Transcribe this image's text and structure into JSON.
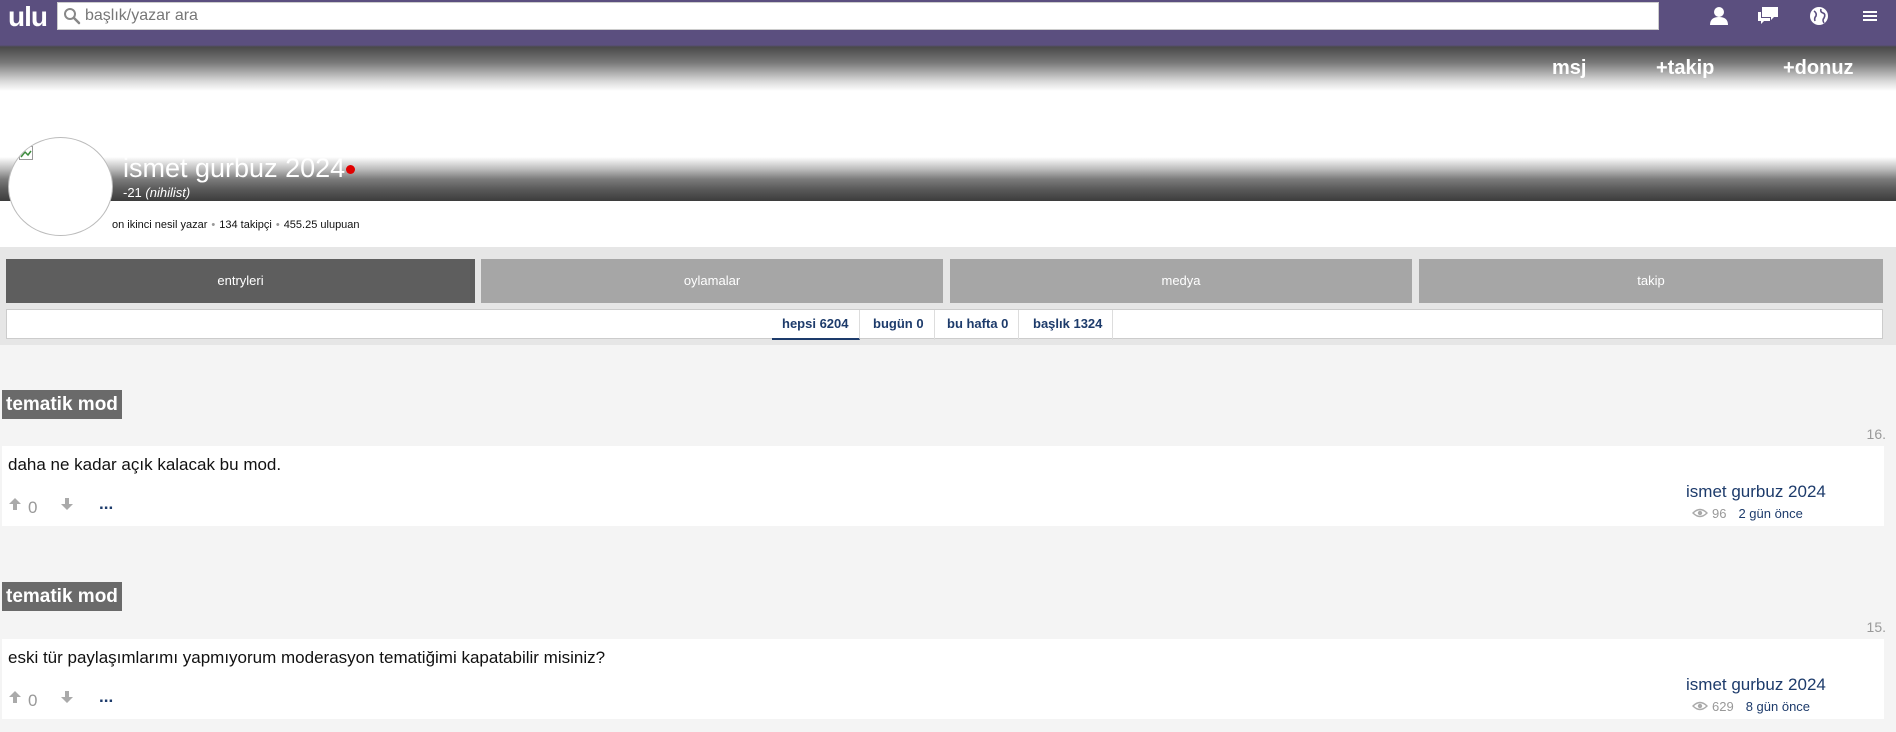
{
  "header": {
    "logo": "ulu",
    "search_placeholder": "başlık/yazar ara",
    "icons": [
      "user-icon",
      "messages-icon",
      "globe-icon",
      "menu-icon"
    ]
  },
  "cover": {
    "buttons": [
      "msj",
      "+takip",
      "+donuz"
    ]
  },
  "profile": {
    "name": "ismet gurbuz 2024",
    "score": "-21",
    "type": "(nihilist)",
    "stats": [
      "on ikinci nesil yazar",
      "134 takipçi",
      "455.25 ulupuan"
    ],
    "online_color": "#e00000"
  },
  "tabs": [
    {
      "label": "entryleri",
      "active": true
    },
    {
      "label": "oylamalar",
      "active": false
    },
    {
      "label": "medya",
      "active": false
    },
    {
      "label": "takip",
      "active": false
    }
  ],
  "subtabs": [
    {
      "label": "hepsi 6204",
      "active": true
    },
    {
      "label": "bugün 0",
      "active": false
    },
    {
      "label": "bu hafta 0",
      "active": false
    },
    {
      "label": "başlık 1324",
      "active": false
    }
  ],
  "entries": [
    {
      "topic": "tematik mod",
      "number": "16.",
      "text": "daha ne kadar açık kalacak bu mod.",
      "votes": "0",
      "more": "...",
      "author": "ismet gurbuz 2024",
      "views": "96",
      "time": "2 gün önce"
    },
    {
      "topic": "tematik mod",
      "number": "15.",
      "text": "eski tür paylaşımlarımı yapmıyorum moderasyon tematiğimi kapatabilir misiniz?",
      "votes": "0",
      "more": "...",
      "author": "ismet gurbuz 2024",
      "views": "629",
      "time": "8 gün önce"
    }
  ],
  "colors": {
    "header_bg": "#5b4f7f",
    "tab_active": "#5e5e5e",
    "tab_inactive": "#a6a6a6",
    "link": "#1d3b6b"
  }
}
